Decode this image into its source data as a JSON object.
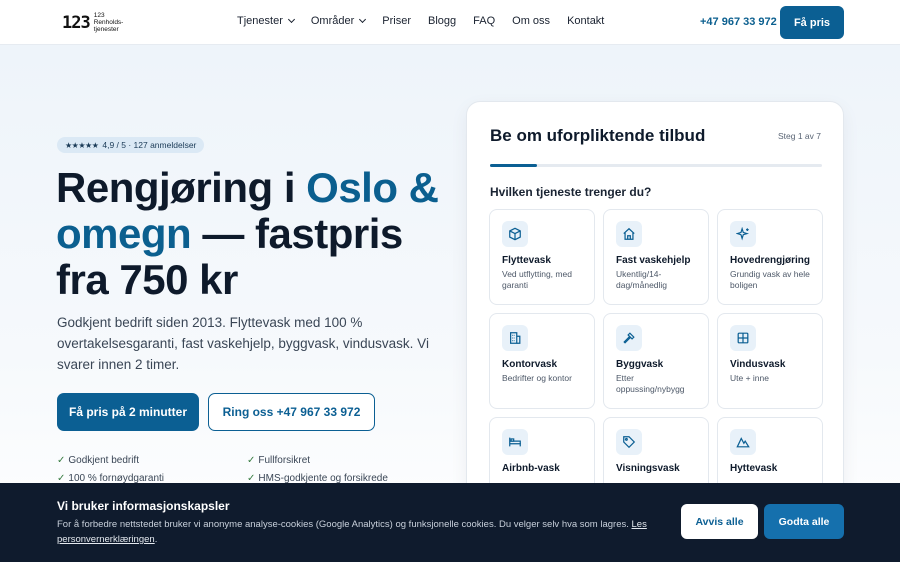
{
  "nav": {
    "logo_mark": "123",
    "logo_text": "123 Renholds-tjenester",
    "menu": [
      {
        "label": "Tjenester",
        "has_dropdown": true
      },
      {
        "label": "Områder",
        "has_dropdown": true
      },
      {
        "label": "Priser",
        "has_dropdown": false
      },
      {
        "label": "Blogg",
        "has_dropdown": false
      },
      {
        "label": "FAQ",
        "has_dropdown": false
      },
      {
        "label": "Om oss",
        "has_dropdown": false
      },
      {
        "label": "Kontakt",
        "has_dropdown": false
      }
    ],
    "phone": "+47 967 33 972",
    "cta": "Få pris"
  },
  "hero": {
    "rating_stars": "★★★★★",
    "rating_text": "4,9 / 5 · 127 anmeldelser",
    "title_part1": "Rengjøring i ",
    "title_accent": "Oslo & omegn",
    "title_part2": " — fastpris fra 750 kr",
    "subtitle": "Godkjent bedrift siden 2013. Flyttevask med 100 % overtakelsesgaranti, fast vaskehjelp, byggvask, vindusvask. Vi svarer innen 2 timer.",
    "primary_button": "Få pris på 2 minutter",
    "secondary_button": "Ring oss +47 967 33 972",
    "checks": [
      "Godkjent bedrift",
      "Fullforsikret",
      "100 % fornøydgaranti",
      "HMS-godkjente og forsikrede"
    ]
  },
  "form": {
    "title": "Be om uforpliktende tilbud",
    "step": "Steg 1 av 7",
    "progress": 0.143,
    "question": "Hvilken tjeneste trenger du?",
    "services": [
      {
        "name": "Flyttevask",
        "desc": "Ved utflytting, med garanti",
        "icon": "box-icon"
      },
      {
        "name": "Fast vaskehjelp",
        "desc": "Ukentlig/14-dag/månedlig",
        "icon": "home-icon"
      },
      {
        "name": "Hovedrengjøring",
        "desc": "Grundig vask av hele boligen",
        "icon": "sparkle-icon"
      },
      {
        "name": "Kontorvask",
        "desc": "Bedrifter og kontor",
        "icon": "building-icon"
      },
      {
        "name": "Byggvask",
        "desc": "Etter oppussing/nybygg",
        "icon": "hammer-icon"
      },
      {
        "name": "Vindusvask",
        "desc": "Ute + inne",
        "icon": "window-icon"
      },
      {
        "name": "Airbnb-vask",
        "desc": "",
        "icon": "bed-icon"
      },
      {
        "name": "Visningsvask",
        "desc": "",
        "icon": "tag-icon"
      },
      {
        "name": "Hyttevask",
        "desc": "",
        "icon": "mountain-icon"
      }
    ]
  },
  "cookie": {
    "title": "Vi bruker informasjonskapsler",
    "text": "For å forbedre nettstedet bruker vi anonyme analyse-cookies (Google Analytics) og funksjonelle cookies. Du velger selv hva som lagres. ",
    "link": "Les personvernerklæringen",
    "text_end": ".",
    "reject": "Avvis alle",
    "accept": "Godta alle"
  },
  "colors": {
    "brand": "#0b5f93",
    "accent_text": "#0b5f8f",
    "cookie_bg": "#0f1b2d"
  }
}
